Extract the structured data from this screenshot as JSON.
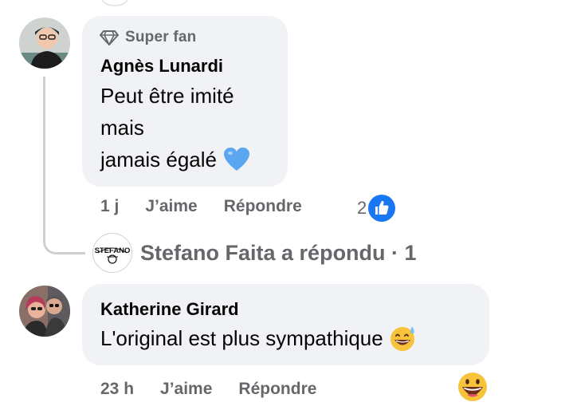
{
  "comment1": {
    "badge": "Super fan",
    "author": "Agnès Lunardi",
    "lines": [
      "Peut être imité",
      "mais",
      "jamais égalé"
    ],
    "time": "1 j",
    "like": "J’aime",
    "reply": "Répondre",
    "reactions": "2",
    "heart_icon": "blue-heart-emoji",
    "like_icon": "thumbs-up-icon"
  },
  "reply_summary": {
    "logo_text": "STEFANO",
    "text": "Stefano Faita a répondu · 1"
  },
  "comment2": {
    "author": "Katherine Girard",
    "text": "L'original est plus sympathique",
    "emoji": "grinning-sweat-emoji",
    "time": "23 h",
    "like": "J’aime",
    "reply": "Répondre",
    "reaction_emoji": "grinning-face-emoji"
  },
  "colors": {
    "bubble": "#f0f2f5",
    "meta": "#65676b",
    "like_blue": "#1877f2",
    "heart": "#5aa6f0"
  }
}
